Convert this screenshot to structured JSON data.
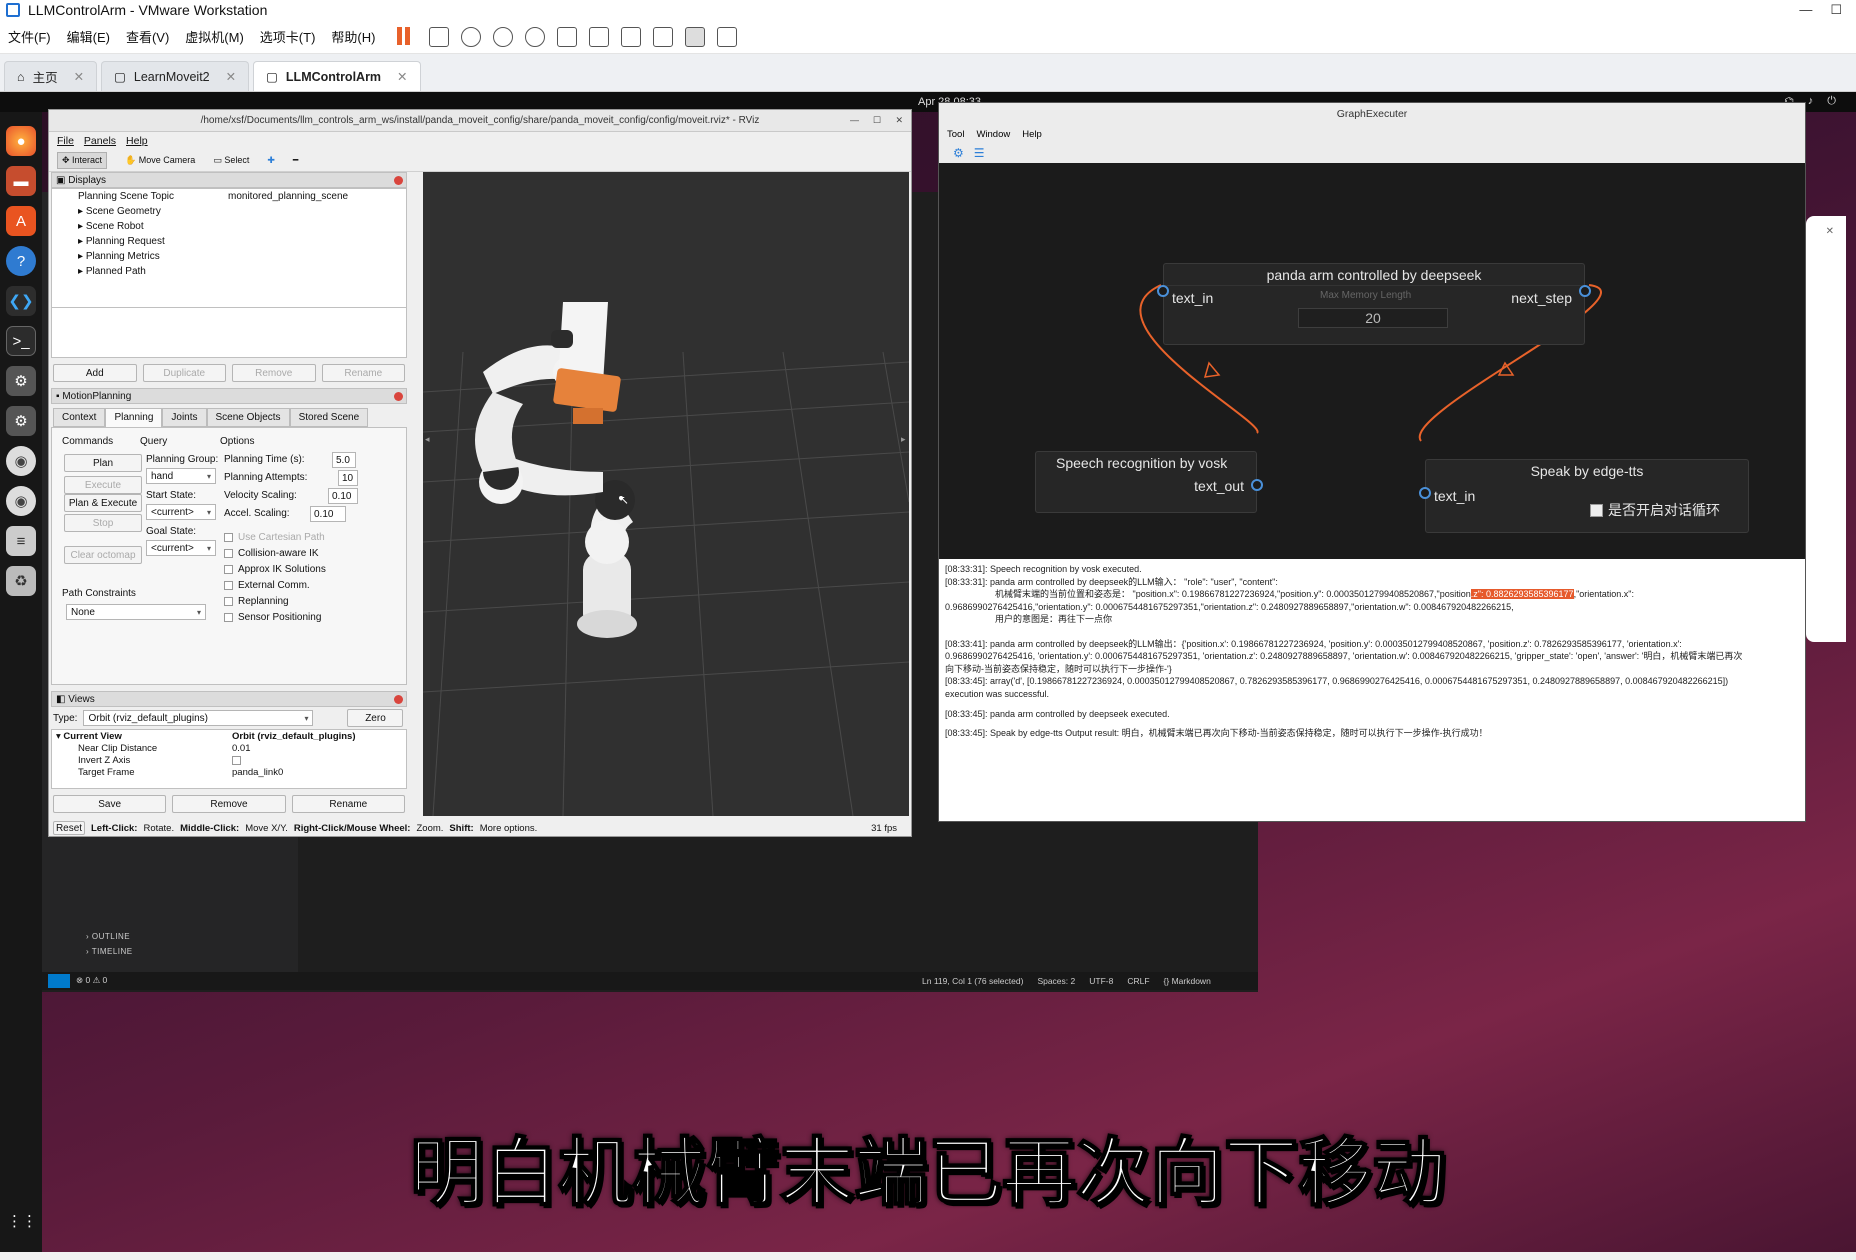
{
  "vm": {
    "title": "LLMControlArm - VMware Workstation",
    "menu": [
      "文件(F)",
      "编辑(E)",
      "查看(V)",
      "虚拟机(M)",
      "选项卡(T)",
      "帮助(H)"
    ],
    "tabs": [
      {
        "label": "主页",
        "active": false
      },
      {
        "label": "LearnMoveit2",
        "active": false
      },
      {
        "label": "LLMControlArm",
        "active": true
      }
    ]
  },
  "guest": {
    "clock": "Apr 28  08:33",
    "accent_colors": {
      "ubuntu_orange": "#e95420",
      "vscode_blue": "#007acc"
    }
  },
  "vscode": {
    "outline": "OUTLINE",
    "timeline": "TIMELINE",
    "status_errors": "⊗ 0 ⚠ 0",
    "status_items": [
      "Ln 119, Col 1 (76 selected)",
      "Spaces: 2",
      "UTF-8",
      "CRLF",
      "{} Markdown"
    ]
  },
  "rviz": {
    "title": "/home/xsf/Documents/llm_controls_arm_ws/install/panda_moveit_config/share/panda_moveit_config/config/moveit.rviz* - RViz",
    "menu": [
      "File",
      "Panels",
      "Help"
    ],
    "tools": [
      "Interact",
      "Move Camera",
      "Select"
    ],
    "displays": {
      "header": "Displays",
      "rows": [
        {
          "key": "Planning Scene Topic",
          "value": "monitored_planning_scene"
        },
        {
          "key": "Scene Geometry",
          "value": ""
        },
        {
          "key": "Scene Robot",
          "value": ""
        },
        {
          "key": "Planning Request",
          "value": ""
        },
        {
          "key": "Planning Metrics",
          "value": ""
        },
        {
          "key": "Planned Path",
          "value": ""
        }
      ],
      "buttons": [
        "Add",
        "Duplicate",
        "Remove",
        "Rename"
      ]
    },
    "motion_planning": {
      "header": "MotionPlanning",
      "tabs": [
        "Context",
        "Planning",
        "Joints",
        "Scene Objects",
        "Stored Scene"
      ],
      "commands_label": "Commands",
      "query_label": "Query",
      "options_label": "Options",
      "commands": [
        "Plan",
        "Execute",
        "Plan & Execute",
        "Stop",
        "Clear octomap"
      ],
      "planning_group_label": "Planning Group:",
      "planning_group": "hand",
      "start_state_label": "Start State:",
      "start_state": "<current>",
      "goal_state_label": "Goal State:",
      "goal_state": "<current>",
      "planning_time_label": "Planning Time (s):",
      "planning_time": "5.0",
      "planning_attempts_label": "Planning Attempts:",
      "planning_attempts": "10",
      "velocity_scaling_label": "Velocity Scaling:",
      "velocity_scaling": "0.10",
      "accel_scaling_label": "Accel. Scaling:",
      "accel_scaling": "0.10",
      "checkboxes": [
        "Use Cartesian Path",
        "Collision-aware IK",
        "Approx IK Solutions",
        "External Comm.",
        "Replanning",
        "Sensor Positioning"
      ],
      "path_constraints_label": "Path Constraints",
      "path_constraints": "None"
    },
    "views": {
      "header": "Views",
      "type_label": "Type:",
      "type": "Orbit (rviz_default_plugins)",
      "zero": "Zero",
      "rows": [
        {
          "key": "Current View",
          "value": "Orbit (rviz_default_plugins)"
        },
        {
          "key": "Near Clip Distance",
          "value": "0.01"
        },
        {
          "key": "Invert Z Axis",
          "value": ""
        },
        {
          "key": "Target Frame",
          "value": "panda_link0"
        }
      ],
      "buttons": [
        "Save",
        "Remove",
        "Rename"
      ]
    },
    "status": {
      "reset": "Reset",
      "left": "Left-Click:",
      "left_t": "Rotate.",
      "middle": "Middle-Click:",
      "middle_t": "Move X/Y.",
      "right": "Right-Click/Mouse Wheel:",
      "right_t": "Zoom.",
      "shift": "Shift:",
      "shift_t": "More options.",
      "fps": "31 fps"
    }
  },
  "graph": {
    "title": "GraphExecuter",
    "menu": [
      "Tool",
      "Window",
      "Help"
    ],
    "nodes": {
      "arm": {
        "title": "panda arm controlled by deepseek",
        "in": "text_in",
        "out": "next_step",
        "param_label": "Max Memory Length",
        "param_value": "20"
      },
      "vosk": {
        "title": "Speech recognition by vosk",
        "out": "text_out"
      },
      "tts": {
        "title": "Speak by edge-tts",
        "in": "text_in",
        "checkbox": "是否开启对话循环"
      }
    },
    "edge_color": "#e8622a",
    "log": [
      "[08:33:31]: Speech recognition by vosk executed.",
      "[08:33:31]: panda arm controlled by deepseek的LLM输入：  \"role\": \"user\", \"content\":",
      "机械臂末端的当前位置和姿态是： \"position.x\": 0.19866781227236924,\"position.y\": 0.00035012799408520867,\"position",
      ".z\": 0.8826293585396177",
      ",\"orientation.x\":",
      "0.9686990276425416,\"orientation.y\": 0.0006754481675297351,\"orientation.z\": 0.2480927889658897,\"orientation.w\": 0.008467920482266215,",
      "用户的意图是：再往下一点你",
      "[08:33:41]: panda arm controlled by deepseek的LLM输出：{'position.x': 0.19866781227236924, 'position.y': 0.00035012799408520867, 'position.z': 0.7826293585396177, 'orientation.x':",
      "0.9686990276425416, 'orientation.y': 0.0006754481675297351, 'orientation.z': 0.2480927889658897, 'orientation.w': 0.008467920482266215, 'gripper_state': 'open', 'answer': '明白，机械臂末端已再次",
      "向下移动-当前姿态保持稳定，随时可以执行下一步操作-'}",
      "[08:33:45]: array('d', [0.19866781227236924, 0.00035012799408520867, 0.7826293585396177, 0.9686990276425416, 0.0006754481675297351, 0.2480927889658897, 0.008467920482266215])",
      "execution was successful.",
      "[08:33:45]: panda arm controlled by deepseek executed.",
      "[08:33:45]: Speak by edge-tts Output result: 明白，机械臂末端已再次向下移动-当前姿态保持稳定，随时可以执行下一步操作-执行成功！"
    ]
  },
  "subtitle": "明白机械臂末端已再次向下移动"
}
